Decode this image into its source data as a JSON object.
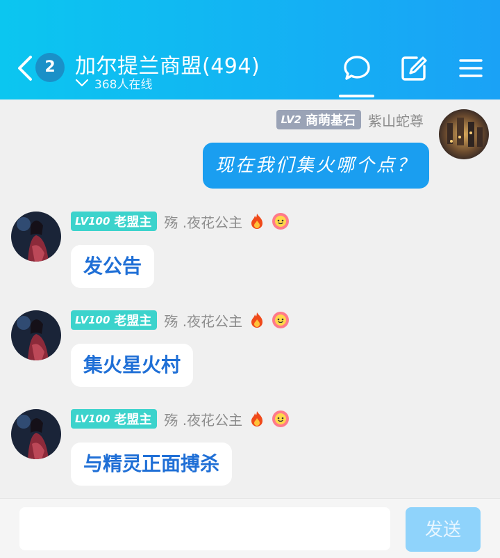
{
  "header": {
    "unread_count": "2",
    "title": "加尔提兰商盟(494)",
    "online_text": "368人在线",
    "icons": [
      "back-icon",
      "chat-bubble-icon",
      "edit-icon",
      "menu-icon"
    ]
  },
  "messages": [
    {
      "self": true,
      "level_tag": "LV2",
      "level_title": "商萌基石",
      "nickname": "紫山蛇尊",
      "text": "现在我们集火哪个点？"
    },
    {
      "self": false,
      "level_tag": "LV100",
      "level_title": "老盟主",
      "nickname": "殇 .夜花公主",
      "text": "发公告"
    },
    {
      "self": false,
      "level_tag": "LV100",
      "level_title": "老盟主",
      "nickname": "殇 .夜花公主",
      "text": "集火星火村"
    },
    {
      "self": false,
      "level_tag": "LV100",
      "level_title": "老盟主",
      "nickname": "殇 .夜花公主",
      "text": "与精灵正面搏杀"
    }
  ],
  "composer": {
    "input_value": "",
    "send_label": "发送"
  },
  "colors": {
    "header_start": "#0bc6f0",
    "header_end": "#1aa2f6",
    "my_bubble": "#1a9ef0",
    "level_badge_teal": "#3cd3cc",
    "level_badge_gray": "#9aa3b6",
    "send_disabled": "#8fd3fb"
  }
}
